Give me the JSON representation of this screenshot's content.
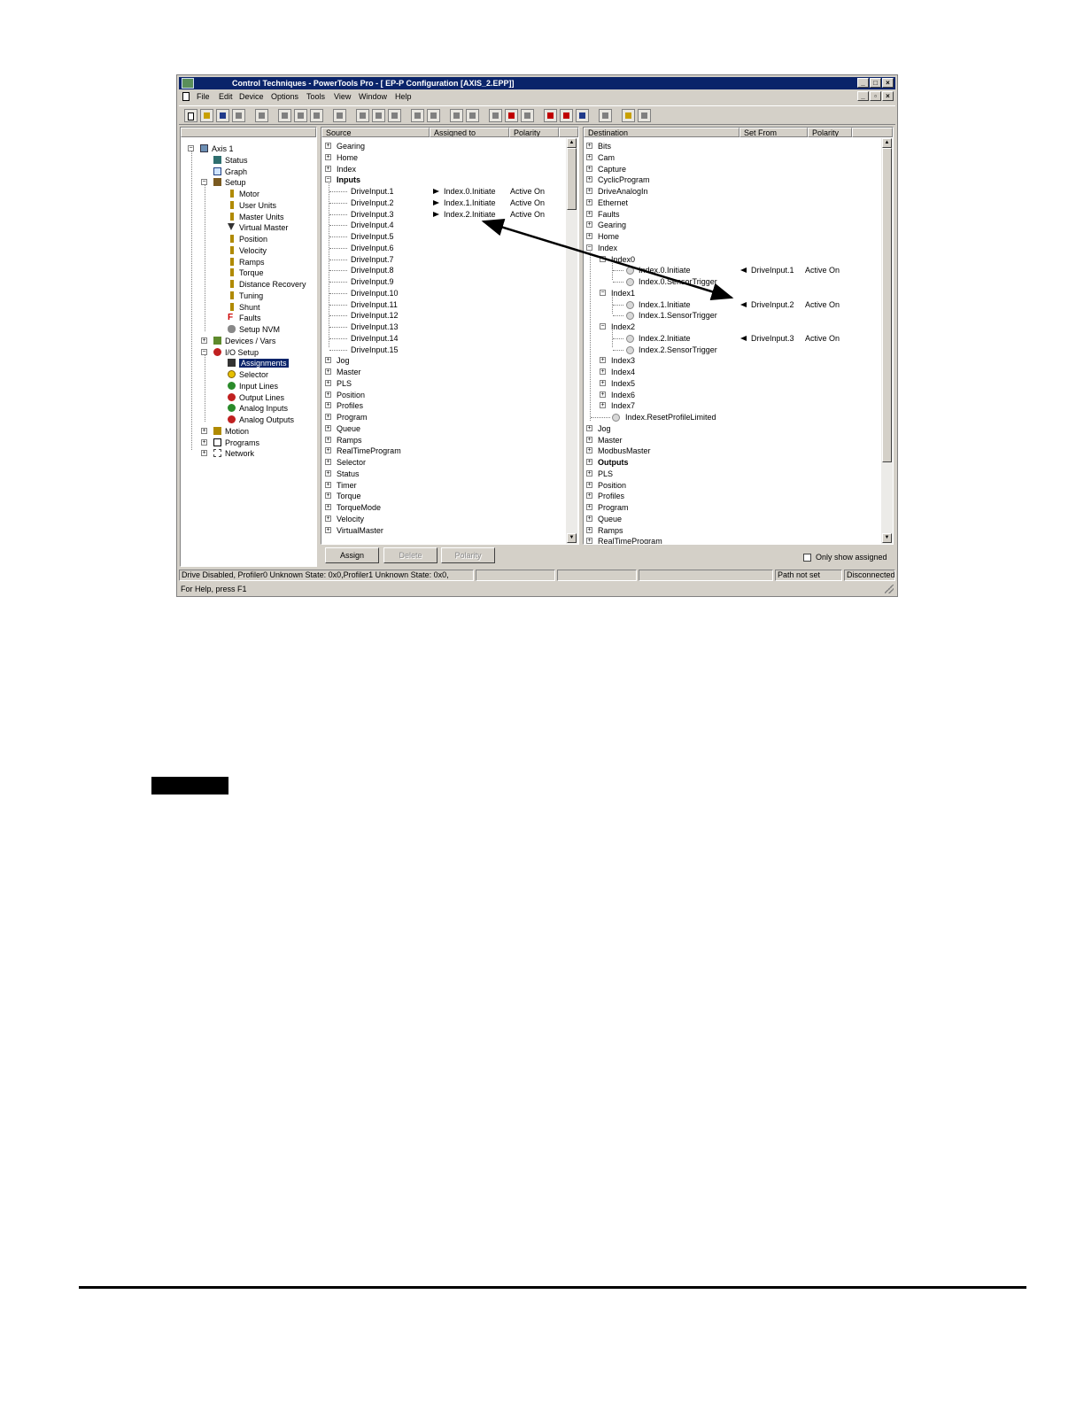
{
  "window": {
    "title": "Control Techniques - PowerTools Pro - [ EP-P Configuration  [AXIS_2.EPP]]",
    "caption_buttons": [
      "_",
      "□",
      "×"
    ],
    "mdi_buttons": [
      "_",
      "▫",
      "×"
    ]
  },
  "menu": [
    "File",
    "Edit",
    "Device",
    "Options",
    "Tools",
    "View",
    "Window",
    "Help"
  ],
  "tree": {
    "root": "Axis 1",
    "items": [
      {
        "label": "Status"
      },
      {
        "label": "Graph"
      },
      {
        "label": "Setup"
      },
      {
        "label": "Motor"
      },
      {
        "label": "User Units"
      },
      {
        "label": "Master Units"
      },
      {
        "label": "Virtual Master"
      },
      {
        "label": "Position"
      },
      {
        "label": "Velocity"
      },
      {
        "label": "Ramps"
      },
      {
        "label": "Torque"
      },
      {
        "label": "Distance Recovery"
      },
      {
        "label": "Tuning"
      },
      {
        "label": "Shunt"
      },
      {
        "label": "Faults"
      },
      {
        "label": "Setup NVM"
      },
      {
        "label": "Devices / Vars"
      },
      {
        "label": "I/O Setup"
      },
      {
        "label": "Assignments"
      },
      {
        "label": "Selector"
      },
      {
        "label": "Input Lines"
      },
      {
        "label": "Output Lines"
      },
      {
        "label": "Analog Inputs"
      },
      {
        "label": "Analog Outputs"
      },
      {
        "label": "Motion"
      },
      {
        "label": "Programs"
      },
      {
        "label": "Network"
      }
    ]
  },
  "source": {
    "headers": [
      "Source",
      "Assigned to",
      "Polarity"
    ],
    "top": [
      "Gearing",
      "Home",
      "Index"
    ],
    "inputs_label": "Inputs",
    "inputs": [
      {
        "name": "DriveInput.1",
        "assigned": "Index.0.Initiate",
        "polarity": "Active On"
      },
      {
        "name": "DriveInput.2",
        "assigned": "Index.1.Initiate",
        "polarity": "Active On"
      },
      {
        "name": "DriveInput.3",
        "assigned": "Index.2.Initiate",
        "polarity": "Active On"
      },
      {
        "name": "DriveInput.4"
      },
      {
        "name": "DriveInput.5"
      },
      {
        "name": "DriveInput.6"
      },
      {
        "name": "DriveInput.7"
      },
      {
        "name": "DriveInput.8"
      },
      {
        "name": "DriveInput.9"
      },
      {
        "name": "DriveInput.10"
      },
      {
        "name": "DriveInput.11"
      },
      {
        "name": "DriveInput.12"
      },
      {
        "name": "DriveInput.13"
      },
      {
        "name": "DriveInput.14"
      },
      {
        "name": "DriveInput.15"
      }
    ],
    "bottom": [
      "Jog",
      "Master",
      "PLS",
      "Position",
      "Profiles",
      "Program",
      "Queue",
      "Ramps",
      "RealTimeProgram",
      "Selector",
      "Status",
      "Timer",
      "Torque",
      "TorqueMode",
      "Velocity",
      "VirtualMaster"
    ]
  },
  "destination": {
    "headers": [
      "Destination",
      "Set From",
      "Polarity"
    ],
    "top": [
      "Bits",
      "Cam",
      "Capture",
      "CyclicProgram",
      "DriveAnalogIn",
      "Ethernet",
      "Faults",
      "Gearing",
      "Home"
    ],
    "index_label": "Index",
    "groups": [
      {
        "label": "Index0",
        "items": [
          {
            "name": "Index.0.Initiate",
            "from": "DriveInput.1",
            "polarity": "Active On"
          },
          {
            "name": "Index.0.SensorTrigger"
          }
        ]
      },
      {
        "label": "Index1",
        "items": [
          {
            "name": "Index.1.Initiate",
            "from": "DriveInput.2",
            "polarity": "Active On"
          },
          {
            "name": "Index.1.SensorTrigger"
          }
        ]
      },
      {
        "label": "Index2",
        "items": [
          {
            "name": "Index.2.Initiate",
            "from": "DriveInput.3",
            "polarity": "Active On"
          },
          {
            "name": "Index.2.SensorTrigger"
          }
        ]
      }
    ],
    "collapsed": [
      "Index3",
      "Index4",
      "Index5",
      "Index6",
      "Index7"
    ],
    "reset": "Index.ResetProfileLimited",
    "bottom": [
      "Jog",
      "Master",
      "ModbusMaster",
      "Outputs",
      "PLS",
      "Position",
      "Profiles",
      "Program",
      "Queue",
      "Ramps",
      "RealTimeProgram"
    ],
    "bold": [
      "Outputs"
    ]
  },
  "buttons": {
    "assign": "Assign",
    "delete": "Delete",
    "polarity": "Polarity"
  },
  "only_assigned": "Only show assigned",
  "status": {
    "cells": [
      "Drive Disabled, Profiler0 Unknown State: 0x0,Profiler1 Unknown State: 0x0,",
      "",
      "",
      "",
      "Path not set",
      "Disconnected"
    ],
    "help": "For Help, press F1"
  }
}
